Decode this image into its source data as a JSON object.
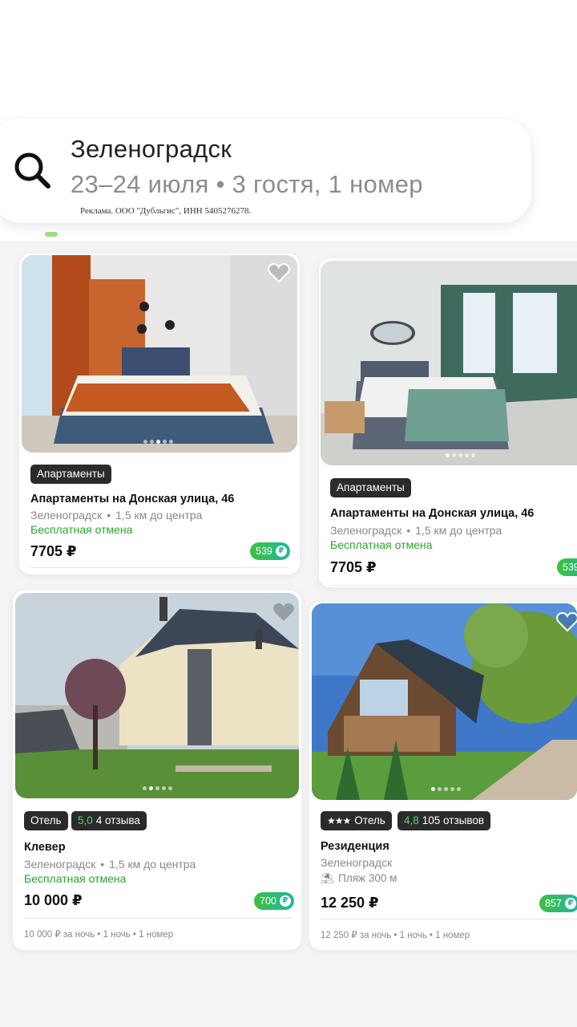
{
  "search": {
    "city": "Зеленоградск",
    "dates_guests": "23–24 июля • 3 гостя, 1 номер",
    "ad_notice": "Реклама. ООО \"Дубльгис\", ИНН 5405276278."
  },
  "listings": [
    {
      "type": "Апартаменты",
      "title": "Апартаменты на Донская улица, 46",
      "city": "Зеленоградск",
      "distance": "1,5 км до центра",
      "cancel": "Бесплатная отмена",
      "price": "7705 ₽",
      "bonus": "539"
    },
    {
      "type": "Апартаменты",
      "title": "Апартаменты на Донская улица, 46",
      "city": "Зеленоградск",
      "distance": "1,5 км до центра",
      "cancel": "Бесплатная отмена",
      "price": "7705 ₽",
      "bonus": "539"
    },
    {
      "type": "Отель",
      "rating": "5,0",
      "reviews": "4 отзыва",
      "title": "Клевер",
      "city": "Зеленоградск",
      "distance": "1,5 км до центра",
      "cancel": "Бесплатная отмена",
      "price": "10 000 ₽",
      "bonus": "700",
      "price_note": "10 000 ₽ за ночь • 1 ночь • 1 номер"
    },
    {
      "stars": "★★★",
      "type": "Отель",
      "rating": "4,8",
      "reviews": "105 отзывов",
      "title": "Резиденция",
      "city": "Зеленоградск",
      "beach": "Пляж 300 м",
      "price": "12 250 ₽",
      "bonus": "857",
      "price_note": "12 250 ₽ за ночь • 1 ночь • 1 номер"
    }
  ],
  "colors": {
    "accent_green": "#2aa52a",
    "badge_dark": "#2b2b2b",
    "bonus_start": "#3fbf3f",
    "bonus_end": "#1fb8a4"
  },
  "icons": [
    "search-icon",
    "heart-icon",
    "bonus-icon",
    "beach-umbrella-icon"
  ]
}
